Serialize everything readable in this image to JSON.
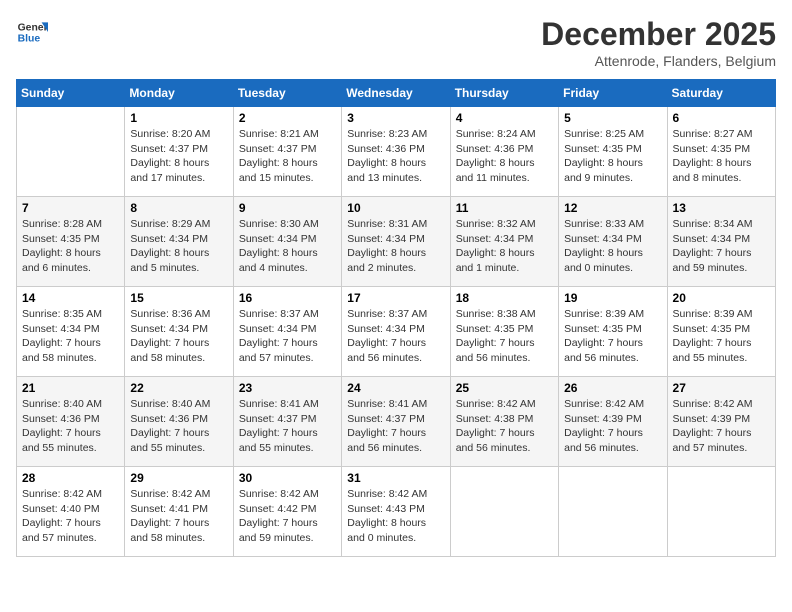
{
  "logo": {
    "line1": "General",
    "line2": "Blue"
  },
  "title": "December 2025",
  "subtitle": "Attenrode, Flanders, Belgium",
  "days_of_week": [
    "Sunday",
    "Monday",
    "Tuesday",
    "Wednesday",
    "Thursday",
    "Friday",
    "Saturday"
  ],
  "weeks": [
    [
      {
        "empty": true
      },
      {
        "day": "1",
        "sunrise": "8:20 AM",
        "sunset": "4:37 PM",
        "daylight": "8 hours and 17 minutes."
      },
      {
        "day": "2",
        "sunrise": "8:21 AM",
        "sunset": "4:37 PM",
        "daylight": "8 hours and 15 minutes."
      },
      {
        "day": "3",
        "sunrise": "8:23 AM",
        "sunset": "4:36 PM",
        "daylight": "8 hours and 13 minutes."
      },
      {
        "day": "4",
        "sunrise": "8:24 AM",
        "sunset": "4:36 PM",
        "daylight": "8 hours and 11 minutes."
      },
      {
        "day": "5",
        "sunrise": "8:25 AM",
        "sunset": "4:35 PM",
        "daylight": "8 hours and 9 minutes."
      },
      {
        "day": "6",
        "sunrise": "8:27 AM",
        "sunset": "4:35 PM",
        "daylight": "8 hours and 8 minutes."
      }
    ],
    [
      {
        "day": "7",
        "sunrise": "8:28 AM",
        "sunset": "4:35 PM",
        "daylight": "8 hours and 6 minutes."
      },
      {
        "day": "8",
        "sunrise": "8:29 AM",
        "sunset": "4:34 PM",
        "daylight": "8 hours and 5 minutes."
      },
      {
        "day": "9",
        "sunrise": "8:30 AM",
        "sunset": "4:34 PM",
        "daylight": "8 hours and 4 minutes."
      },
      {
        "day": "10",
        "sunrise": "8:31 AM",
        "sunset": "4:34 PM",
        "daylight": "8 hours and 2 minutes."
      },
      {
        "day": "11",
        "sunrise": "8:32 AM",
        "sunset": "4:34 PM",
        "daylight": "8 hours and 1 minute."
      },
      {
        "day": "12",
        "sunrise": "8:33 AM",
        "sunset": "4:34 PM",
        "daylight": "8 hours and 0 minutes."
      },
      {
        "day": "13",
        "sunrise": "8:34 AM",
        "sunset": "4:34 PM",
        "daylight": "7 hours and 59 minutes."
      }
    ],
    [
      {
        "day": "14",
        "sunrise": "8:35 AM",
        "sunset": "4:34 PM",
        "daylight": "7 hours and 58 minutes."
      },
      {
        "day": "15",
        "sunrise": "8:36 AM",
        "sunset": "4:34 PM",
        "daylight": "7 hours and 58 minutes."
      },
      {
        "day": "16",
        "sunrise": "8:37 AM",
        "sunset": "4:34 PM",
        "daylight": "7 hours and 57 minutes."
      },
      {
        "day": "17",
        "sunrise": "8:37 AM",
        "sunset": "4:34 PM",
        "daylight": "7 hours and 56 minutes."
      },
      {
        "day": "18",
        "sunrise": "8:38 AM",
        "sunset": "4:35 PM",
        "daylight": "7 hours and 56 minutes."
      },
      {
        "day": "19",
        "sunrise": "8:39 AM",
        "sunset": "4:35 PM",
        "daylight": "7 hours and 56 minutes."
      },
      {
        "day": "20",
        "sunrise": "8:39 AM",
        "sunset": "4:35 PM",
        "daylight": "7 hours and 55 minutes."
      }
    ],
    [
      {
        "day": "21",
        "sunrise": "8:40 AM",
        "sunset": "4:36 PM",
        "daylight": "7 hours and 55 minutes."
      },
      {
        "day": "22",
        "sunrise": "8:40 AM",
        "sunset": "4:36 PM",
        "daylight": "7 hours and 55 minutes."
      },
      {
        "day": "23",
        "sunrise": "8:41 AM",
        "sunset": "4:37 PM",
        "daylight": "7 hours and 55 minutes."
      },
      {
        "day": "24",
        "sunrise": "8:41 AM",
        "sunset": "4:37 PM",
        "daylight": "7 hours and 56 minutes."
      },
      {
        "day": "25",
        "sunrise": "8:42 AM",
        "sunset": "4:38 PM",
        "daylight": "7 hours and 56 minutes."
      },
      {
        "day": "26",
        "sunrise": "8:42 AM",
        "sunset": "4:39 PM",
        "daylight": "7 hours and 56 minutes."
      },
      {
        "day": "27",
        "sunrise": "8:42 AM",
        "sunset": "4:39 PM",
        "daylight": "7 hours and 57 minutes."
      }
    ],
    [
      {
        "day": "28",
        "sunrise": "8:42 AM",
        "sunset": "4:40 PM",
        "daylight": "7 hours and 57 minutes."
      },
      {
        "day": "29",
        "sunrise": "8:42 AM",
        "sunset": "4:41 PM",
        "daylight": "7 hours and 58 minutes."
      },
      {
        "day": "30",
        "sunrise": "8:42 AM",
        "sunset": "4:42 PM",
        "daylight": "7 hours and 59 minutes."
      },
      {
        "day": "31",
        "sunrise": "8:42 AM",
        "sunset": "4:43 PM",
        "daylight": "8 hours and 0 minutes."
      },
      {
        "empty": true
      },
      {
        "empty": true
      },
      {
        "empty": true
      }
    ]
  ],
  "labels": {
    "sunrise": "Sunrise:",
    "sunset": "Sunset:",
    "daylight": "Daylight:"
  }
}
